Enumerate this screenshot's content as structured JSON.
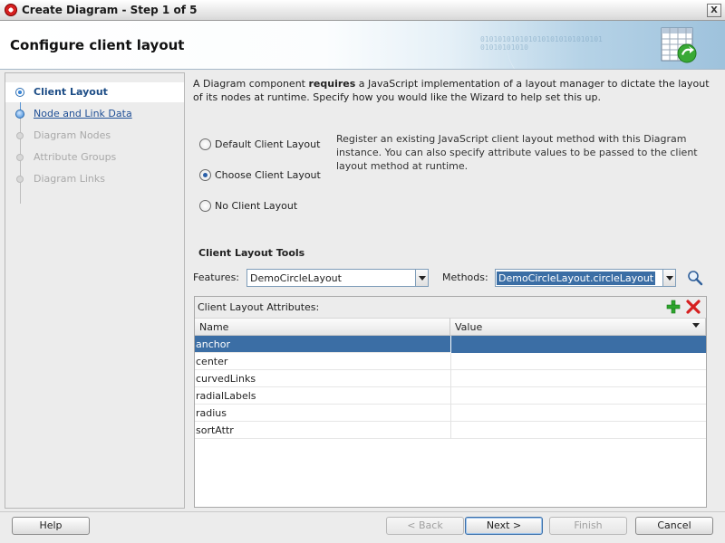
{
  "window": {
    "title": "Create Diagram - Step 1 of 5",
    "close_glyph": "X"
  },
  "banner": {
    "title": "Configure client layout",
    "bits": "0101010101010101010101010101\n01010101010"
  },
  "steps": [
    {
      "label": "Client Layout",
      "state": "selected"
    },
    {
      "label": "Node and Link Data",
      "state": "link"
    },
    {
      "label": "Diagram Nodes",
      "state": "disabled"
    },
    {
      "label": "Attribute Groups",
      "state": "disabled"
    },
    {
      "label": "Diagram Links",
      "state": "disabled"
    }
  ],
  "intro": {
    "part1": "A Diagram component ",
    "bold": "requires",
    "part2": " a JavaScript implementation of a layout manager to dictate the layout of its nodes at runtime. Specify how you would like the Wizard to help set this up."
  },
  "options": {
    "default": "Default Client Layout",
    "choose": "Choose Client Layout",
    "none": "No Client Layout",
    "selected": "choose"
  },
  "option_help": "Register an existing JavaScript client layout method with this Diagram instance. You can also specify attribute values to be passed to the client layout method at runtime.",
  "tools": {
    "title": "Client Layout Tools",
    "features_label": "Features:",
    "features_value": "DemoCircleLayout",
    "methods_label": "Methods:",
    "methods_value": "DemoCircleLayout.circleLayout"
  },
  "attributes": {
    "title": "Client Layout Attributes:",
    "columns": [
      "Name",
      "Value"
    ],
    "rows": [
      "anchor",
      "center",
      "curvedLinks",
      "radialLabels",
      "radius",
      "sortAttr"
    ],
    "selected_row": 0
  },
  "buttons": {
    "help": "Help",
    "back": "< Back",
    "next": "Next >",
    "finish": "Finish",
    "cancel": "Cancel"
  },
  "colors": {
    "selection": "#3b6ea5",
    "link": "#1f4f96",
    "add": "#2ea52e",
    "delete": "#d62020"
  }
}
